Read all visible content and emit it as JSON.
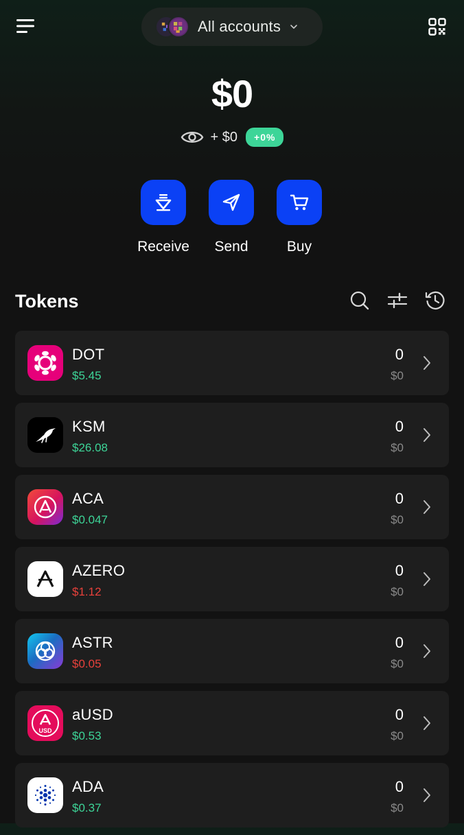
{
  "header": {
    "account_label": "All accounts",
    "menu_icon": "hamburger-menu-icon",
    "qr_icon": "qr-scan-icon"
  },
  "portfolio": {
    "balance": "$0",
    "change_value": "+ $0",
    "change_percent": "+0%"
  },
  "actions": [
    {
      "label": "Receive",
      "icon": "receive-download-icon"
    },
    {
      "label": "Send",
      "icon": "send-paper-plane-icon"
    },
    {
      "label": "Buy",
      "icon": "shopping-cart-icon"
    }
  ],
  "tokens_section": {
    "title": "Tokens",
    "icons": [
      "search-icon",
      "filter-sliders-icon",
      "history-icon"
    ]
  },
  "tokens": [
    {
      "symbol": "DOT",
      "price": "$5.45",
      "trend": "up",
      "amount": "0",
      "fiat": "$0",
      "logo_color": "#e6007a"
    },
    {
      "symbol": "KSM",
      "price": "$26.08",
      "trend": "up",
      "amount": "0",
      "fiat": "$0",
      "logo_color": "#000000"
    },
    {
      "symbol": "ACA",
      "price": "$0.047",
      "trend": "up",
      "amount": "0",
      "fiat": "$0",
      "logo_color": "#e40c5b"
    },
    {
      "symbol": "AZERO",
      "price": "$1.12",
      "trend": "down",
      "amount": "0",
      "fiat": "$0",
      "logo_color": "#ffffff"
    },
    {
      "symbol": "ASTR",
      "price": "$0.05",
      "trend": "down",
      "amount": "0",
      "fiat": "$0",
      "logo_color": "#1b6dc1"
    },
    {
      "symbol": "aUSD",
      "price": "$0.53",
      "trend": "up",
      "amount": "0",
      "fiat": "$0",
      "logo_color": "#e40c5b",
      "logo_text": "USD"
    },
    {
      "symbol": "ADA",
      "price": "$0.37",
      "trend": "up",
      "amount": "0",
      "fiat": "$0",
      "logo_color": "#ffffff"
    }
  ],
  "colors": {
    "accent_blue": "#0b41f5",
    "positive": "#3dd598",
    "negative": "#e8413b",
    "card_bg": "#1e1e1e"
  }
}
